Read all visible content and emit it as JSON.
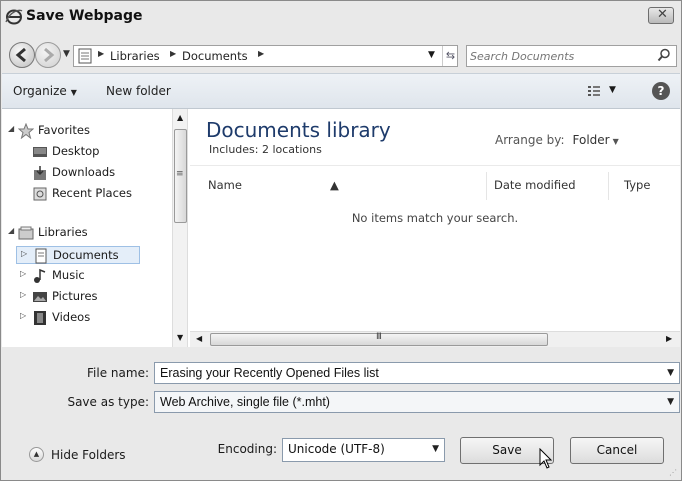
{
  "window": {
    "title": "Save Webpage",
    "close_glyph": "✕"
  },
  "navbar": {
    "breadcrumbs": [
      "Libraries",
      "Documents"
    ],
    "search_placeholder": "Search Documents"
  },
  "toolbar": {
    "organize_label": "Organize",
    "new_folder_label": "New folder",
    "help_glyph": "?"
  },
  "nav_pane": {
    "favorites": {
      "label": "Favorites",
      "items": [
        "Desktop",
        "Downloads",
        "Recent Places"
      ]
    },
    "libraries": {
      "label": "Libraries",
      "items": [
        "Documents",
        "Music",
        "Pictures",
        "Videos"
      ],
      "selected": "Documents"
    }
  },
  "content": {
    "title": "Documents library",
    "subtitle": "Includes:  2 locations",
    "arrange_label": "Arrange by:",
    "arrange_value": "Folder",
    "columns": [
      "Name",
      "Date modified",
      "Type"
    ],
    "empty_message": "No items match your search."
  },
  "form": {
    "file_name_label": "File name:",
    "file_name_value": "Erasing your Recently Opened Files list",
    "save_type_label": "Save as type:",
    "save_type_value": "Web Archive, single file (*.mht)",
    "encoding_label": "Encoding:",
    "encoding_value": "Unicode (UTF-8)"
  },
  "footer": {
    "hide_folders_label": "Hide Folders",
    "save_label": "Save",
    "cancel_label": "Cancel"
  }
}
